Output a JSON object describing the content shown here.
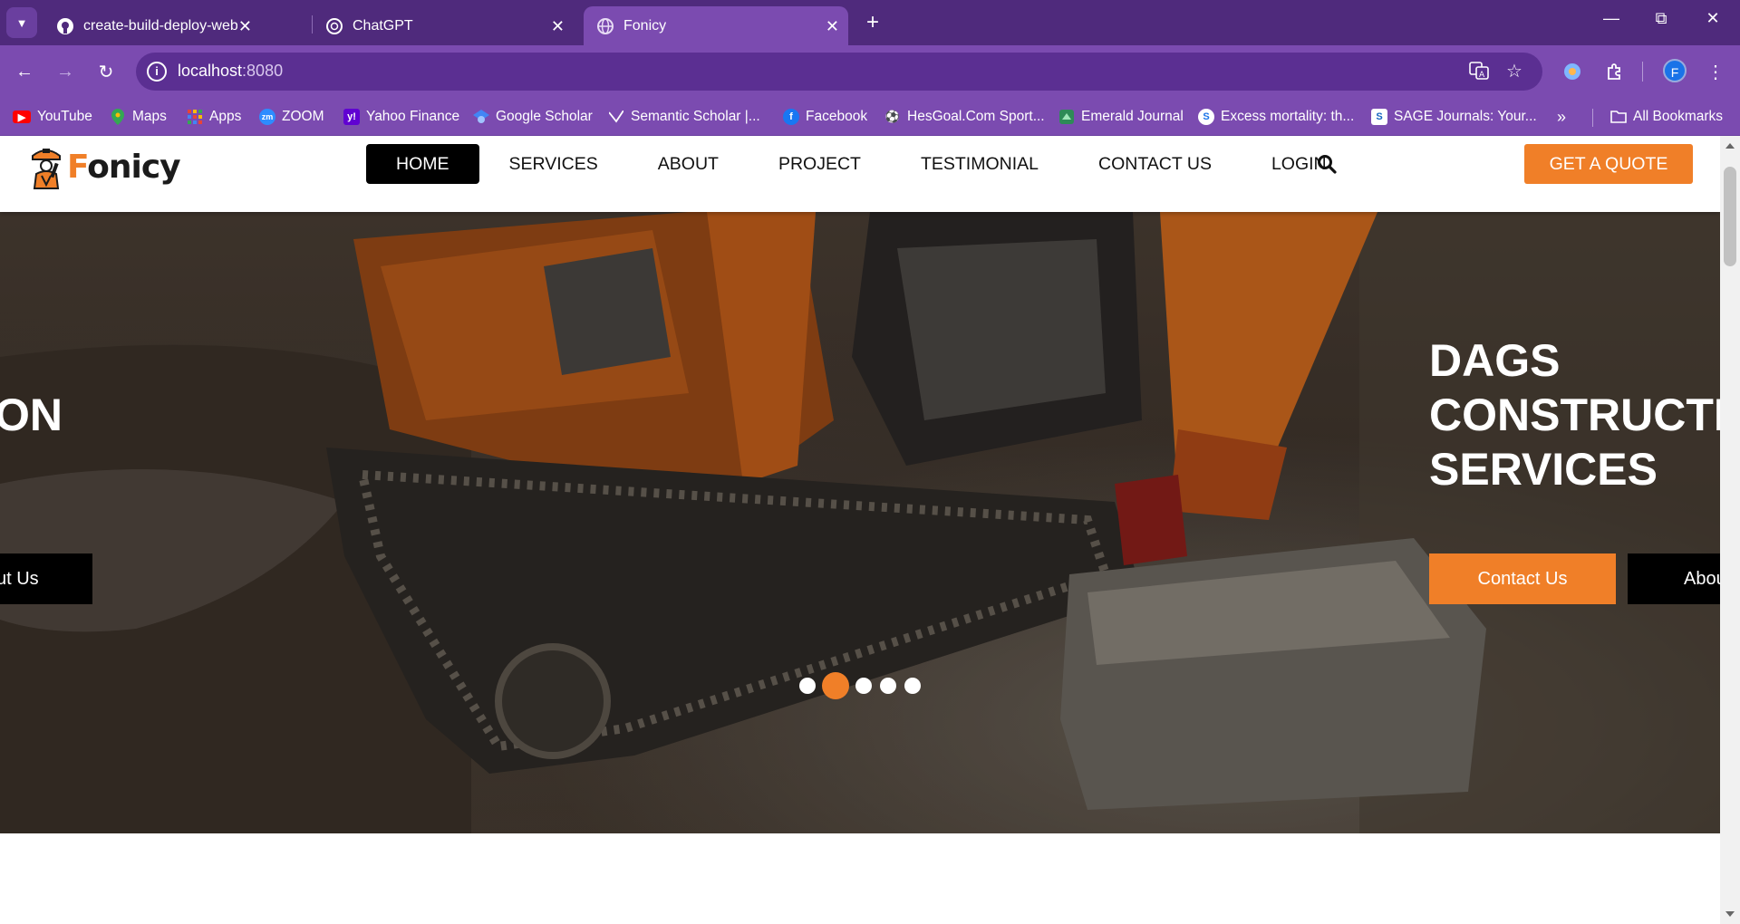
{
  "browser": {
    "tabs": [
      {
        "title": "create-build-deploy-webapp-w",
        "icon": "github-icon"
      },
      {
        "title": "ChatGPT",
        "icon": "openai-icon"
      },
      {
        "title": "Fonicy",
        "icon": "globe-icon",
        "active": true
      }
    ],
    "url_host": "localhost",
    "url_port": ":8080",
    "profile_initial": "F",
    "bookmarks": [
      {
        "label": "YouTube",
        "icon": "youtube-icon",
        "color": "#ff0000"
      },
      {
        "label": "Maps",
        "icon": "maps-icon",
        "color": "#34a853"
      },
      {
        "label": "Apps",
        "icon": "apps-grid-icon",
        "color": "#ea4335"
      },
      {
        "label": "ZOOM",
        "icon": "zoom-icon",
        "color": "#2d8cff"
      },
      {
        "label": "Yahoo Finance",
        "icon": "yahoo-icon",
        "color": "#6001d2"
      },
      {
        "label": "Google Scholar",
        "icon": "scholar-icon",
        "color": "#4285f4"
      },
      {
        "label": "Semantic Scholar |...",
        "icon": "semantic-scholar-icon",
        "color": "#ffffff"
      },
      {
        "label": "Facebook",
        "icon": "facebook-icon",
        "color": "#1877f2"
      },
      {
        "label": "HesGoal.Com Sport...",
        "icon": "hesgoal-icon",
        "color": "#ffffff"
      },
      {
        "label": "Emerald Journal",
        "icon": "emerald-icon",
        "color": "#2e8b57"
      },
      {
        "label": "Excess mortality: th...",
        "icon": "excess-icon",
        "color": "#1a73e8"
      },
      {
        "label": "SAGE Journals: Your...",
        "icon": "sage-icon",
        "color": "#1565c0"
      }
    ],
    "all_bookmarks": "All Bookmarks"
  },
  "site": {
    "brand_prefix": "F",
    "brand_rest": "onicy",
    "nav": [
      "HOME",
      "SERVICES",
      "ABOUT",
      "PROJECT",
      "TESTIMONIAL",
      "CONTACT US",
      "LOGIN"
    ],
    "cta": "GET A QUOTE",
    "accent": "#f07f28"
  },
  "hero": {
    "title_lines": [
      "DAGS",
      "CONSTRUCTION",
      "SERVICES"
    ],
    "prev_title_fragment": "ON",
    "contact_button": "Contact Us",
    "about_button": "About Us",
    "about_button_fragment": "Abou",
    "prev_about_fragment": "ut Us",
    "slides_count": 5,
    "active_slide": 2
  }
}
